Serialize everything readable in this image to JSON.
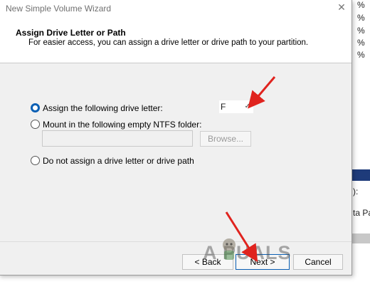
{
  "background_app": {
    "percent_signs": [
      "%",
      "%",
      "%",
      "%",
      "%"
    ],
    "text_1": "):",
    "text_2": "ta Pa"
  },
  "window": {
    "title": "New Simple Volume Wizard",
    "close_glyph": "✕"
  },
  "header": {
    "title": "Assign Drive Letter or Path",
    "subtitle": "For easier access, you can assign a drive letter or drive path to your partition."
  },
  "options": {
    "assign_letter": {
      "label": "Assign the following drive letter:",
      "selected": true
    },
    "mount_folder": {
      "label": "Mount in the following empty NTFS folder:",
      "selected": false
    },
    "no_assign": {
      "label": "Do not assign a drive letter or drive path",
      "selected": false
    }
  },
  "drive_letter_select": {
    "value": "F",
    "chevron": "✓"
  },
  "folder_path": {
    "value": ""
  },
  "browse_button": {
    "label": "Browse..."
  },
  "buttons": {
    "back": "< Back",
    "next": "Next >",
    "cancel": "Cancel"
  },
  "watermark": {
    "text": "A  PUALS"
  },
  "colors": {
    "accent": "#0a5fb4",
    "annotation_arrow": "#e0231e"
  }
}
